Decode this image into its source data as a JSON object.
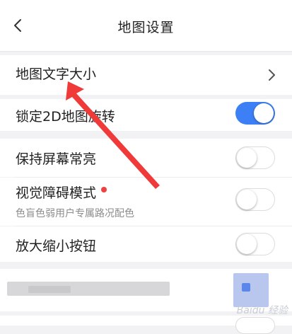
{
  "header": {
    "title": "地图设置",
    "back_icon": "chevron-left-icon"
  },
  "settings": {
    "text_size": {
      "label": "地图文字大小"
    },
    "lock_2d_rotation": {
      "label": "锁定2D地图旋转",
      "enabled": true
    },
    "keep_screen_on": {
      "label": "保持屏幕常亮",
      "enabled": false
    },
    "visual_impairment": {
      "label": "视觉障碍模式",
      "subtitle": "色盲色弱用户专属路况配色",
      "enabled": false
    },
    "zoom_buttons": {
      "label": "放大缩小按钮",
      "enabled": false
    }
  },
  "colors": {
    "accent": "#3d7ff5",
    "badge": "#f04040",
    "annotation_arrow": "#f03a3a"
  }
}
